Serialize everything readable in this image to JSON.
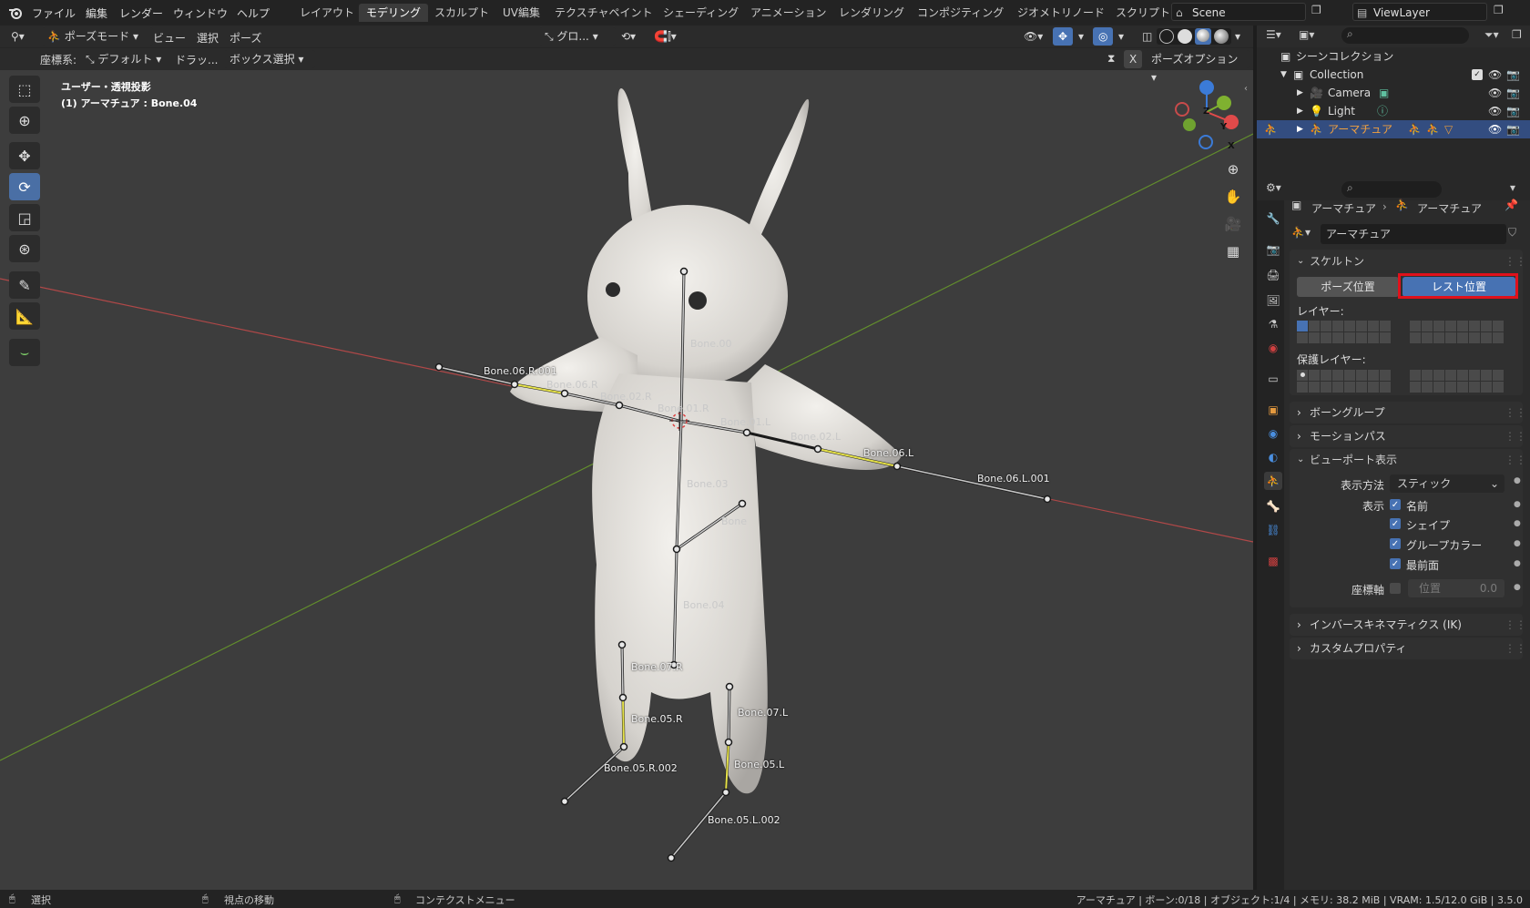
{
  "topbar": {
    "menus": [
      "ファイル",
      "編集",
      "レンダー",
      "ウィンドウ",
      "ヘルプ"
    ],
    "workspaces": [
      "レイアウト",
      "モデリング",
      "スカルプト",
      "UV編集",
      "テクスチャペイント",
      "シェーディング",
      "アニメーション",
      "レンダリング",
      "コンポジティング",
      "ジオメトリノード",
      "スクリプト"
    ],
    "active_workspace": "モデリング",
    "scene": "Scene",
    "view_layer": "ViewLayer"
  },
  "viewport_header": {
    "mode": "ポーズモード",
    "menus": [
      "ビュー",
      "選択",
      "ポーズ"
    ],
    "transform_orientation": "グロ...",
    "pose_options": "ポーズオプション",
    "x_mirror": "X"
  },
  "tool_settings": {
    "orientation_label": "座標系:",
    "orientation_value": "デフォルト",
    "drag_label": "ドラッ...",
    "drag_value": "ボックス選択"
  },
  "viewport": {
    "view_name": "ユーザー・透視投影",
    "object_info": "(1) アーマチュア : Bone.04",
    "bone_labels": [
      "Bone.00",
      "Bone.06.R.001",
      "Bone.06.R",
      "Bone.02.R",
      "Bone.01.R",
      "Bone.01.L",
      "Bone.02.L",
      "Bone.06.L",
      "Bone.06.L.001",
      "Bone.03",
      "Bone",
      "Bone.04",
      "Bone.07.R",
      "Bone.05.R",
      "Bone.05.R.002",
      "Bone.07.L",
      "Bone.05.L",
      "Bone.05.L.002"
    ],
    "gizmo_axes": [
      "Z",
      "Y",
      "X"
    ]
  },
  "outliner": {
    "scene_collection": "シーンコレクション",
    "collection": "Collection",
    "items": [
      {
        "name": "Camera",
        "icon": "camera-icon"
      },
      {
        "name": "Light",
        "icon": "light-icon"
      },
      {
        "name": "アーマチュア",
        "icon": "armature-icon"
      }
    ]
  },
  "properties": {
    "breadcrumb_object": "アーマチュア",
    "breadcrumb_data": "アーマチュア",
    "data_name": "アーマチュア",
    "skeleton": {
      "title": "スケルトン",
      "pose_position": "ポーズ位置",
      "rest_position": "レスト位置",
      "layers_label": "レイヤー:",
      "protected_layers_label": "保護レイヤー:"
    },
    "bone_groups": "ボーングループ",
    "motion_paths": "モーションパス",
    "viewport_display": {
      "title": "ビューポート表示",
      "display_as_label": "表示方法",
      "display_as_value": "スティック",
      "show_label": "表示",
      "names": "名前",
      "shapes": "シェイプ",
      "group_colors": "グループカラー",
      "in_front": "最前面",
      "axes_label": "座標軸",
      "position_label": "位置",
      "position_value": "0.0"
    },
    "ik": "インバースキネマティクス (IK)",
    "custom_props": "カスタムプロパティ"
  },
  "statusbar": {
    "select": "選択",
    "rotate_view": "視点の移動",
    "context_menu": "コンテクストメニュー",
    "stats": "アーマチュア | ボーン:0/18 | オブジェクト:1/4 | メモリ: 38.2 MiB | VRAM: 1.5/12.0 GiB | 3.5.0"
  },
  "colors": {
    "accent": "#4772b3",
    "highlight_box": "#e0111b",
    "x_axis": "#c44a4a",
    "y_axis": "#6c9a2e"
  }
}
